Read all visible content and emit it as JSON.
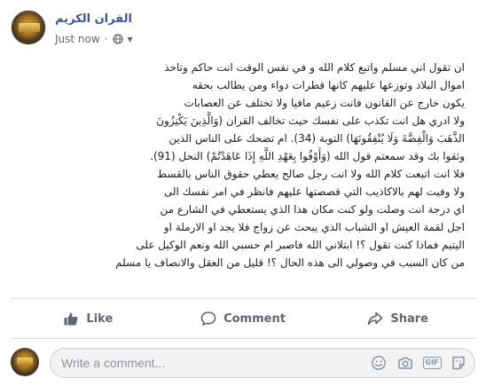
{
  "post": {
    "page_name": "القران الكريم",
    "timestamp": "Just now",
    "separator": "·",
    "audience_icon": "globe-icon",
    "lines": [
      "ان تقول اني مسلم واتبع كلام الله و في نفس الوقت انت حاكم وتاخذ",
      "اموال البلاد وتوزعها عليهم كانها قطرات دواء ومن يطالب بحقه",
      "يكون خارج عن القانون فانت زعيم مافيا ولا تختلف عن العصابات",
      "ولا ادري هل انت تكذب على نفسك حيث تخالف القران (وَالَّذِينَ يَكْنِزُونَ",
      "الذَّهَبَ وَالْفِضَّةَ وَلَا يُنْفِقُونَهَا) التوبة (34). ام تضحك على الناس الذين",
      "وثقوا بك وقد سمعتم قول الله (وَأَوْفُوا بِعَهْدِ اللَّهِ إِذَا عَاهَدْتُمْ) النحل (91).",
      "فلا انت اتبعت كلام الله ولا انت رجل صالح يعطي حقوق الناس بالقسط",
      "ولا وفيت لهم بالاكاذيب التي قصصتها عليهم فانظر في امر نفسك الى",
      "اي درجة انت وصلت ولو كنت مكان هذا الذي يستعطي في الشارع من",
      "اجل لقمة العيش او الشباب الذي يبحث عن زواج فلا يجد او الارملة او",
      "اليتيم فماذا كنت تقول ؟! ابتلاني الله فاصبر ام حسبي الله ونعم الوكيل على",
      "من كان السبب في وصولي الى هذه الحال ؟! قليل من العقل والانصاف يا مسلم"
    ]
  },
  "actions": {
    "like_label": "Like",
    "comment_label": "Comment",
    "share_label": "Share"
  },
  "comment": {
    "placeholder": "Write a comment..."
  },
  "colors": {
    "page_name": "#385898",
    "action_text": "#606770",
    "divider": "#dadde1",
    "input_bg": "#f2f3f5"
  }
}
